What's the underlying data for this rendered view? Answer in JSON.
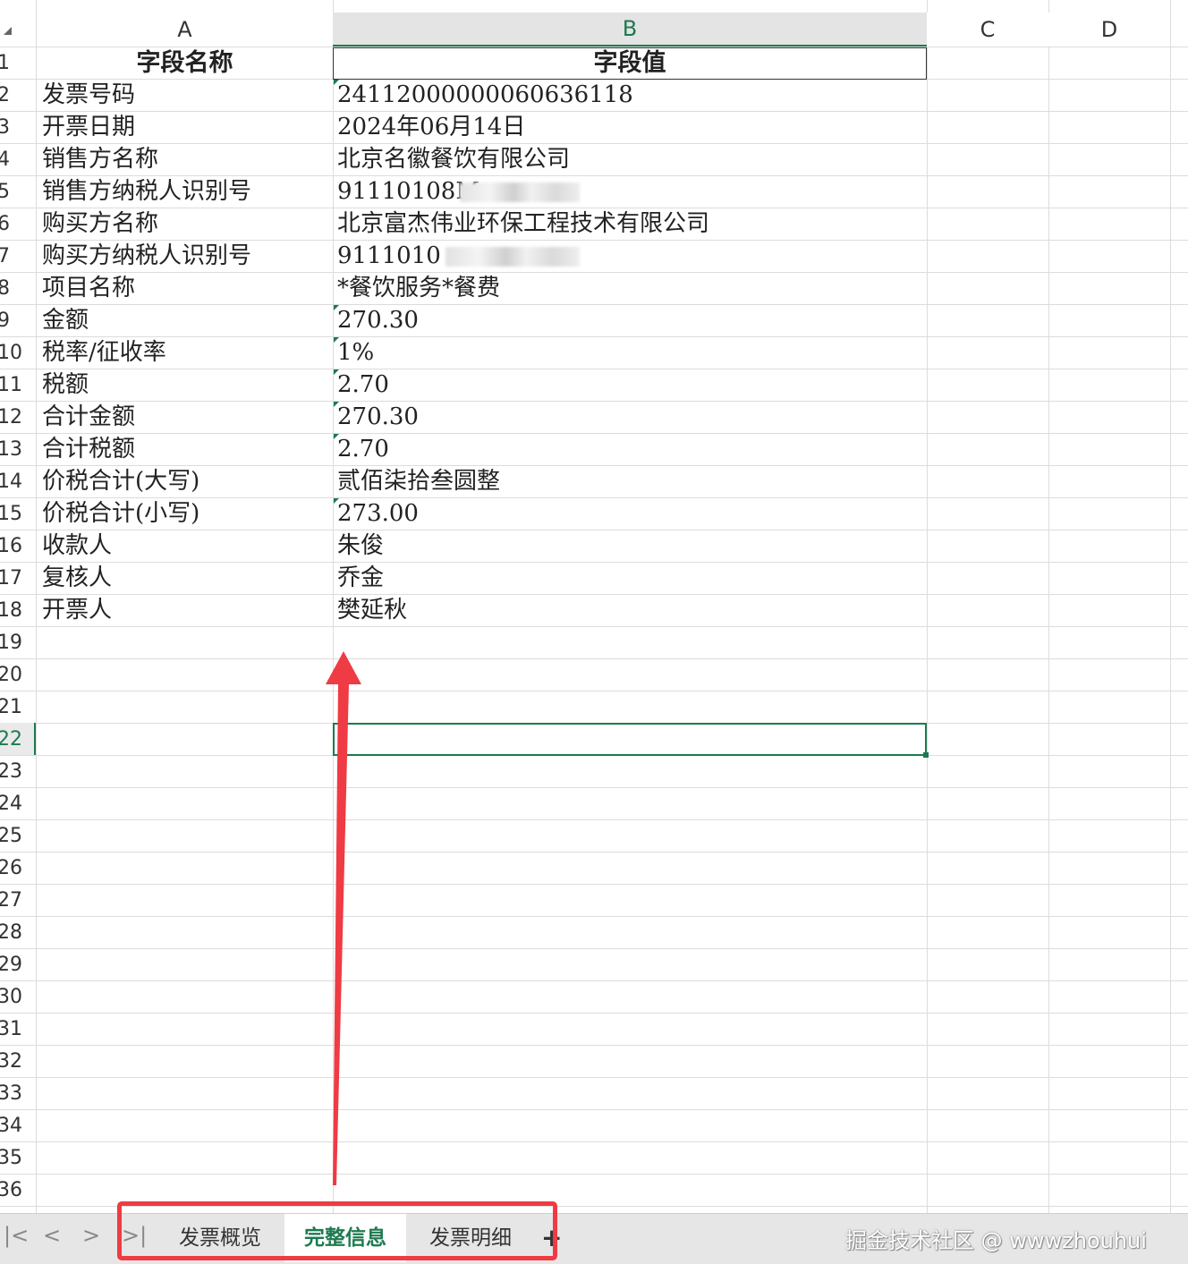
{
  "columns": [
    "A",
    "B",
    "C",
    "D"
  ],
  "row_numbers": [
    "1",
    "2",
    "3",
    "4",
    "5",
    "6",
    "7",
    "8",
    "9",
    "10",
    "11",
    "12",
    "13",
    "14",
    "15",
    "16",
    "17",
    "18",
    "19",
    "20",
    "21",
    "22",
    "23",
    "24",
    "25",
    "26",
    "27",
    "28",
    "29",
    "30",
    "31",
    "32",
    "33",
    "34",
    "35",
    "36"
  ],
  "header_row": {
    "field_name": "字段名称",
    "field_value": "字段值"
  },
  "rows": [
    {
      "name": "发票号码",
      "value": "24112000000060636118"
    },
    {
      "name": "开票日期",
      "value": "2024年06月14日"
    },
    {
      "name": "销售方名称",
      "value": "北京名徽餐饮有限公司"
    },
    {
      "name": "销售方纳税人识别号",
      "value": "91110108M"
    },
    {
      "name": "购买方名称",
      "value": "北京富杰伟业环保工程技术有限公司"
    },
    {
      "name": "购买方纳税人识别号",
      "value": "9111010"
    },
    {
      "name": "项目名称",
      "value": "*餐饮服务*餐费"
    },
    {
      "name": "金额",
      "value": "270.30"
    },
    {
      "name": "税率/征收率",
      "value": "1%"
    },
    {
      "name": "税额",
      "value": "2.70"
    },
    {
      "name": "合计金额",
      "value": "270.30"
    },
    {
      "name": "合计税额",
      "value": "2.70"
    },
    {
      "name": "价税合计(大写)",
      "value": "贰佰柒拾叁圆整"
    },
    {
      "name": "价税合计(小写)",
      "value": "273.00"
    },
    {
      "name": "收款人",
      "value": "朱俊"
    },
    {
      "name": "复核人",
      "value": "乔金"
    },
    {
      "name": "开票人",
      "value": "樊延秋"
    }
  ],
  "selected_cell": {
    "row": "22",
    "column": "B"
  },
  "sheet_tabs": [
    {
      "label": "发票概览",
      "active": false
    },
    {
      "label": "完整信息",
      "active": true
    },
    {
      "label": "发票明细",
      "active": false
    }
  ],
  "add_sheet_label": "+",
  "watermark": "掘金技术社区 @ wwwzhouhui",
  "colors": {
    "accent": "#1d7a4f",
    "annotation": "#ef3b43"
  }
}
